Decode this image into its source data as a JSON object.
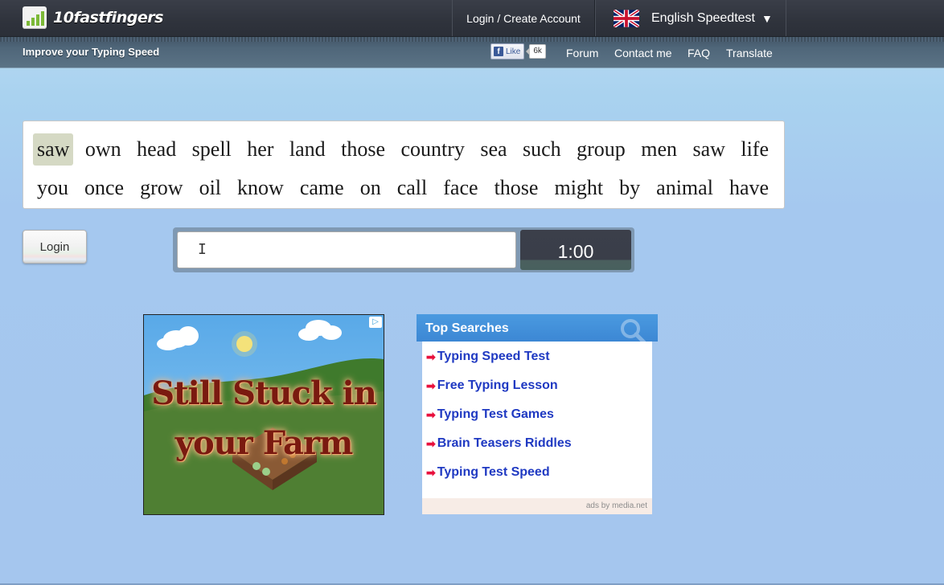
{
  "header": {
    "logo_text": "10fastfingers",
    "logo_icon": "bar-chart-icon",
    "login_create": "Login / Create Account",
    "language": "English Speedtest",
    "language_flag": "uk-flag-icon",
    "dropdown_arrow": "▼"
  },
  "subheader": {
    "tagline": "Improve your Typing Speed",
    "fb_like": "Like",
    "fb_count": "6k",
    "nav": [
      "Forum",
      "Contact me",
      "FAQ",
      "Translate"
    ]
  },
  "typing_test": {
    "words_line1": [
      "saw",
      "own",
      "head",
      "spell",
      "her",
      "land",
      "those",
      "country",
      "sea",
      "such",
      "group",
      "men",
      "saw",
      "life"
    ],
    "words_line2": [
      "you",
      "once",
      "grow",
      "oil",
      "know",
      "came",
      "on",
      "call",
      "face",
      "those",
      "might",
      "by",
      "animal",
      "have"
    ],
    "current_word_index": 0,
    "input_value": "",
    "timer": "1:00",
    "login_button": "Login"
  },
  "ad_banner": {
    "line1": "Still Stuck in",
    "line2": "your Farm",
    "adchoices_icon": "▷"
  },
  "top_searches": {
    "title": "Top Searches",
    "items": [
      "Typing Speed Test",
      "Free Typing Lesson",
      "Typing Test Games",
      "Brain Teasers Riddles",
      "Typing Test Speed"
    ],
    "arrow": "➡",
    "footer": "ads by media.net"
  },
  "colors": {
    "accent_blue": "#3c87d4",
    "link_blue": "#1f39c2",
    "highlight": "#d5d9c4",
    "header_dark": "#2f333c"
  }
}
